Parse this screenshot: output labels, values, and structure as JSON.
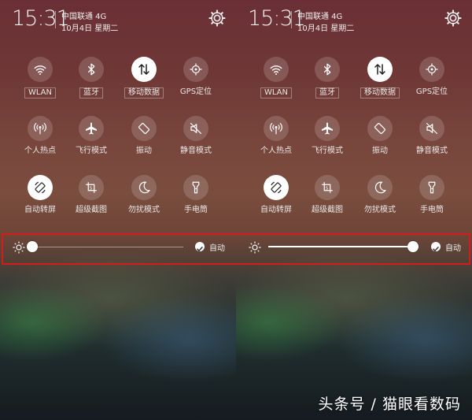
{
  "status": {
    "time": "15:31",
    "carrier": "中国联通 4G",
    "date": "10月4日 星期二"
  },
  "icons": {
    "settings": "gear-icon",
    "brightness": "sun-icon",
    "auto_check": "checkmark-icon"
  },
  "tiles": [
    {
      "label": "WLAN",
      "icon": "wifi-icon"
    },
    {
      "label": "蓝牙",
      "icon": "bluetooth-icon"
    },
    {
      "label": "移动数据",
      "icon": "mobile-data-icon"
    },
    {
      "label": "GPS定位",
      "icon": "gps-icon"
    },
    {
      "label": "个人热点",
      "icon": "hotspot-icon"
    },
    {
      "label": "飞行模式",
      "icon": "airplane-icon"
    },
    {
      "label": "振动",
      "icon": "vibrate-icon"
    },
    {
      "label": "静音模式",
      "icon": "mute-icon"
    },
    {
      "label": "自动转屏",
      "icon": "auto-rotate-icon"
    },
    {
      "label": "超级截图",
      "icon": "screenshot-icon"
    },
    {
      "label": "勿扰模式",
      "icon": "moon-icon"
    },
    {
      "label": "手电筒",
      "icon": "flashlight-icon"
    }
  ],
  "left_panel": {
    "brightness_level": 0,
    "auto_label": "自动"
  },
  "right_panel": {
    "brightness_level": 1,
    "auto_label": "自动"
  },
  "watermark": "头条号 / 猫眼看数码",
  "colors": {
    "highlight_border": "#d51b1b",
    "tile_on": "#ffffff"
  }
}
